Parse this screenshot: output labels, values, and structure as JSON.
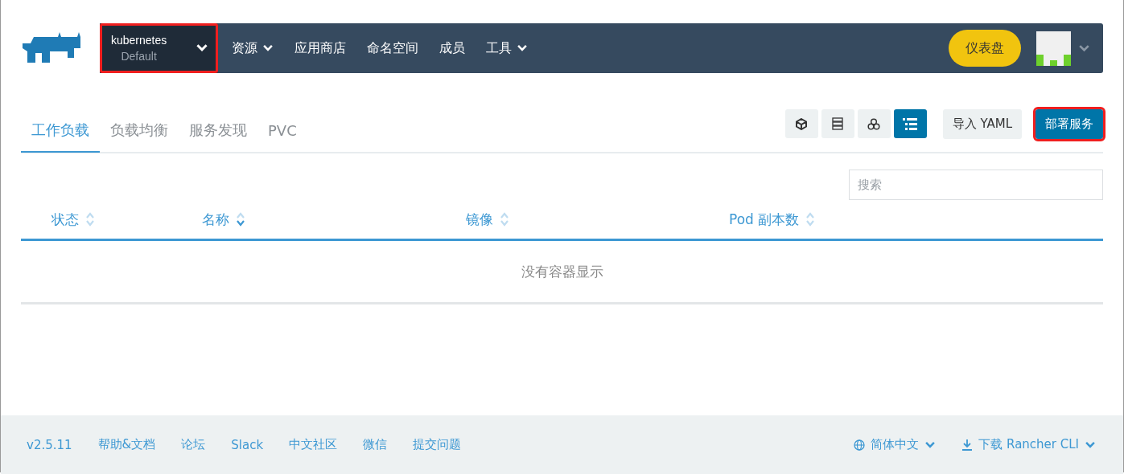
{
  "header": {
    "cluster": {
      "name": "kubernetes",
      "project": "Default",
      "highlighted": true
    },
    "menu": [
      {
        "label": "资源",
        "dropdown": true
      },
      {
        "label": "应用商店",
        "dropdown": false
      },
      {
        "label": "命名空间",
        "dropdown": false
      },
      {
        "label": "成员",
        "dropdown": false
      },
      {
        "label": "工具",
        "dropdown": true
      }
    ],
    "dashboard_button": "仪表盘"
  },
  "tabs": [
    {
      "label": "工作负载",
      "selected": true
    },
    {
      "label": "负载均衡",
      "selected": false
    },
    {
      "label": "服务发现",
      "selected": false
    },
    {
      "label": "PVC",
      "selected": false
    }
  ],
  "view_buttons": [
    {
      "kind": "cube",
      "selected": false
    },
    {
      "kind": "stack",
      "selected": false
    },
    {
      "kind": "cluster",
      "selected": false
    },
    {
      "kind": "list",
      "selected": true
    }
  ],
  "import_button": "导入 YAML",
  "deploy_button": {
    "label": "部署服务",
    "highlighted": true
  },
  "search": {
    "placeholder": "搜索"
  },
  "table": {
    "columns": [
      {
        "label": "状态",
        "sorted": false
      },
      {
        "label": "名称",
        "sorted": true
      },
      {
        "label": "镜像",
        "sorted": false
      },
      {
        "label": "Pod 副本数",
        "sorted": false
      }
    ],
    "empty_message": "没有容器显示"
  },
  "footer": {
    "links": [
      "v2.5.11",
      "帮助&文档",
      "论坛",
      "Slack",
      "中文社区",
      "微信",
      "提交问题"
    ],
    "language": "简体中文",
    "download": "下载 Rancher CLI"
  }
}
